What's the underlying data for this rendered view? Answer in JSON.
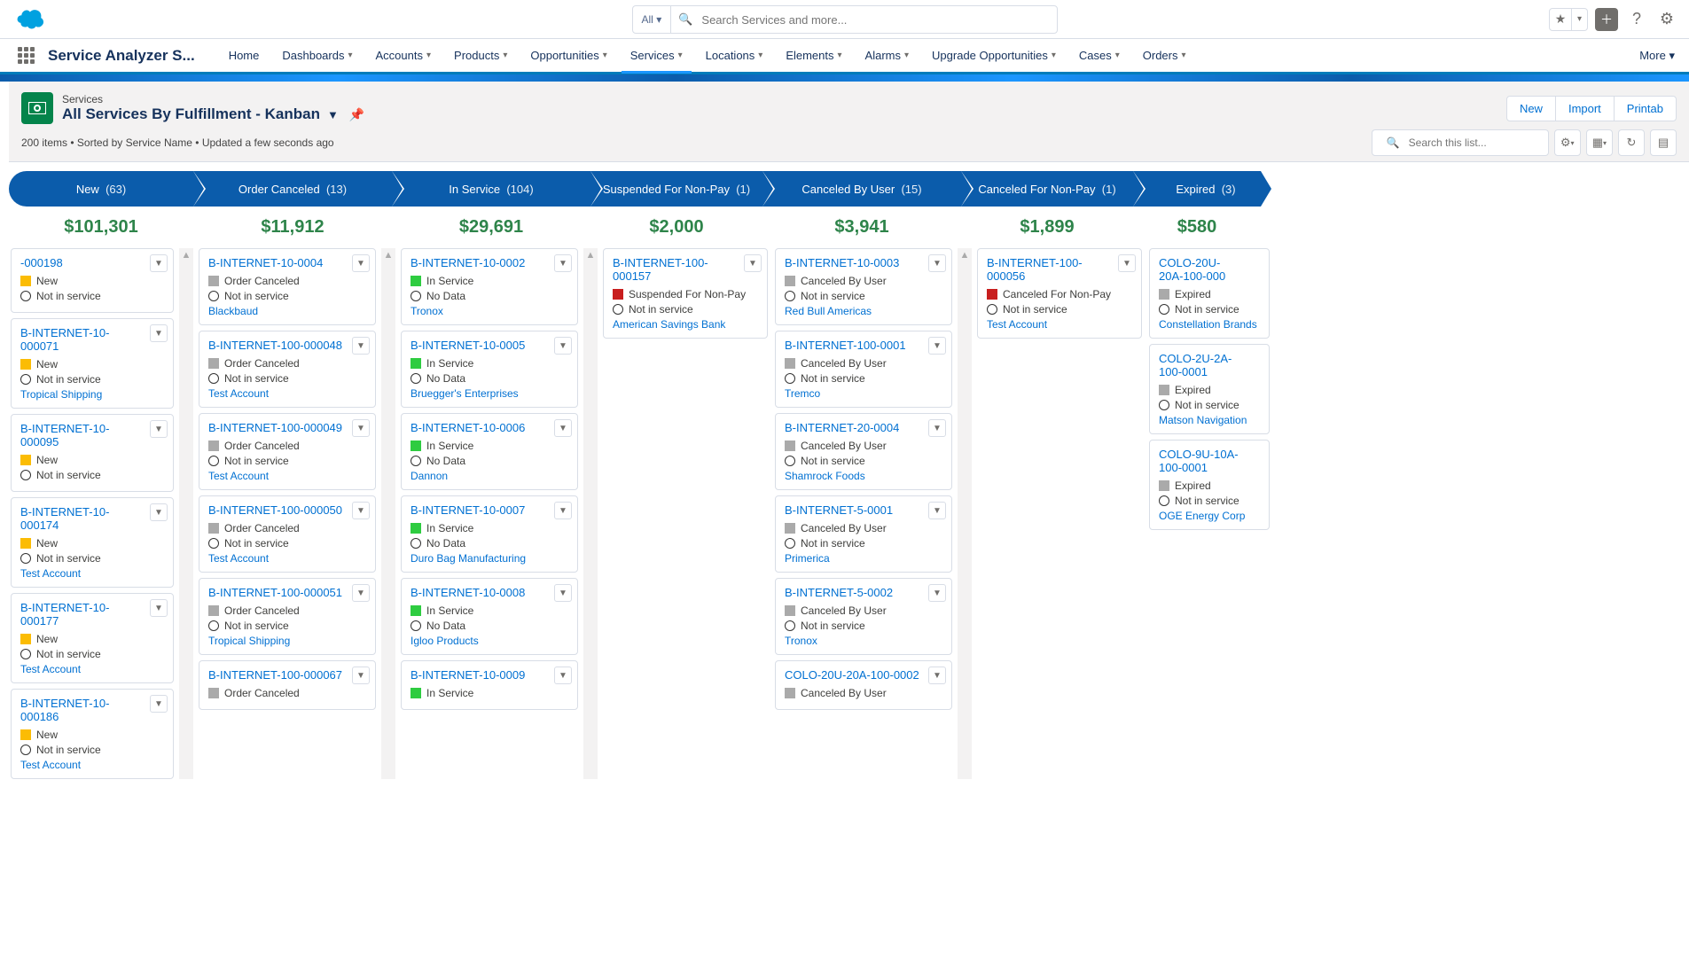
{
  "search": {
    "filter": "All",
    "placeholder": "Search Services and more..."
  },
  "app_name": "Service Analyzer S...",
  "nav": [
    "Home",
    "Dashboards",
    "Accounts",
    "Products",
    "Opportunities",
    "Services",
    "Locations",
    "Elements",
    "Alarms",
    "Upgrade Opportunities",
    "Cases",
    "Orders"
  ],
  "nav_active": "Services",
  "nav_more": "More",
  "header": {
    "object": "Services",
    "view": "All Services By Fulfillment - Kanban",
    "meta": "200 items • Sorted by Service Name • Updated a few seconds ago",
    "actions": [
      "New",
      "Import",
      "Printab"
    ],
    "search_placeholder": "Search this list..."
  },
  "columns": [
    {
      "id": "new",
      "label": "New",
      "count": "(63)",
      "total": "$101,301",
      "w": "wA",
      "scroll": true,
      "swatch": "orange",
      "cards": [
        {
          "title": "-000198",
          "status": "New",
          "sub": "Not in service"
        },
        {
          "title": "B-INTERNET-10-000071",
          "status": "New",
          "sub": "Not in service",
          "account": "Tropical Shipping"
        },
        {
          "title": "B-INTERNET-10-000095",
          "status": "New",
          "sub": "Not in service"
        },
        {
          "title": "B-INTERNET-10-000174",
          "status": "New",
          "sub": "Not in service",
          "account": "Test Account"
        },
        {
          "title": "B-INTERNET-10-000177",
          "status": "New",
          "sub": "Not in service",
          "account": "Test Account"
        },
        {
          "title": "B-INTERNET-10-000186",
          "status": "New",
          "sub": "Not in service",
          "account": "Test Account"
        }
      ]
    },
    {
      "id": "cancel",
      "label": "Order Canceled",
      "count": "(13)",
      "total": "$11,912",
      "w": "wB",
      "scroll": true,
      "swatch": "grey",
      "cards": [
        {
          "title": "B-INTERNET-10-0004",
          "status": "Order Canceled",
          "sub": "Not in service",
          "account": "Blackbaud"
        },
        {
          "title": "B-INTERNET-100-000048",
          "status": "Order Canceled",
          "sub": "Not in service",
          "account": "Test Account"
        },
        {
          "title": "B-INTERNET-100-000049",
          "status": "Order Canceled",
          "sub": "Not in service",
          "account": "Test Account"
        },
        {
          "title": "B-INTERNET-100-000050",
          "status": "Order Canceled",
          "sub": "Not in service",
          "account": "Test Account"
        },
        {
          "title": "B-INTERNET-100-000051",
          "status": "Order Canceled",
          "sub": "Not in service",
          "account": "Tropical Shipping"
        },
        {
          "title": "B-INTERNET-100-000067",
          "status": "Order Canceled"
        }
      ]
    },
    {
      "id": "inservice",
      "label": "In Service",
      "count": "(104)",
      "total": "$29,691",
      "w": "wB",
      "scroll": true,
      "swatch": "green",
      "sub_override": "No Data",
      "cards": [
        {
          "title": "B-INTERNET-10-0002",
          "status": "In Service",
          "sub": "No Data",
          "account": "Tronox"
        },
        {
          "title": "B-INTERNET-10-0005",
          "status": "In Service",
          "sub": "No Data",
          "account": "Bruegger's Enterprises"
        },
        {
          "title": "B-INTERNET-10-0006",
          "status": "In Service",
          "sub": "No Data",
          "account": "Dannon"
        },
        {
          "title": "B-INTERNET-10-0007",
          "status": "In Service",
          "sub": "No Data",
          "account": "Duro Bag Manufacturing"
        },
        {
          "title": "B-INTERNET-10-0008",
          "status": "In Service",
          "sub": "No Data",
          "account": "Igloo Products"
        },
        {
          "title": "B-INTERNET-10-0009",
          "status": "In Service"
        }
      ]
    },
    {
      "id": "susp",
      "label": "Suspended For Non-Pay",
      "count": "(1)",
      "total": "$2,000",
      "w": "wC",
      "swatch": "red",
      "cards": [
        {
          "title": "B-INTERNET-100-000157",
          "status": "Suspended For Non-Pay",
          "sub": "Not in service",
          "account": "American Savings Bank"
        }
      ]
    },
    {
      "id": "cbu",
      "label": "Canceled By User",
      "count": "(15)",
      "total": "$3,941",
      "w": "wB",
      "scroll": true,
      "swatch": "grey",
      "cards": [
        {
          "title": "B-INTERNET-10-0003",
          "status": "Canceled By User",
          "sub": "Not in service",
          "account": "Red Bull Americas"
        },
        {
          "title": "B-INTERNET-100-0001",
          "status": "Canceled By User",
          "sub": "Not in service",
          "account": "Tremco"
        },
        {
          "title": "B-INTERNET-20-0004",
          "status": "Canceled By User",
          "sub": "Not in service",
          "account": "Shamrock Foods"
        },
        {
          "title": "B-INTERNET-5-0001",
          "status": "Canceled By User",
          "sub": "Not in service",
          "account": "Primerica"
        },
        {
          "title": "B-INTERNET-5-0002",
          "status": "Canceled By User",
          "sub": "Not in service",
          "account": "Tronox"
        },
        {
          "title": "COLO-20U-20A-100-0002",
          "status": "Canceled By User"
        }
      ]
    },
    {
      "id": "cnp",
      "label": "Canceled For Non-Pay",
      "count": "(1)",
      "total": "$1,899",
      "w": "wC",
      "swatch": "red",
      "cards": [
        {
          "title": "B-INTERNET-100-000056",
          "status": "Canceled For Non-Pay",
          "sub": "Not in service",
          "account": "Test Account"
        }
      ]
    },
    {
      "id": "exp",
      "label": "Expired",
      "count": "(3)",
      "total": "$580",
      "w": "wE",
      "swatch": "grey",
      "no_menu": true,
      "cards": [
        {
          "title": "COLO-20U-20A-100-000",
          "status": "Expired",
          "sub": "Not in service",
          "account": "Constellation Brands"
        },
        {
          "title": "COLO-2U-2A-100-0001",
          "status": "Expired",
          "sub": "Not in service",
          "account": "Matson Navigation"
        },
        {
          "title": "COLO-9U-10A-100-0001",
          "status": "Expired",
          "sub": "Not in service",
          "account": "OGE Energy Corp"
        }
      ]
    }
  ],
  "column_widths": {
    "wA": 188,
    "wB": 204,
    "wC": 190,
    "wE": 140,
    "sep": 16
  }
}
